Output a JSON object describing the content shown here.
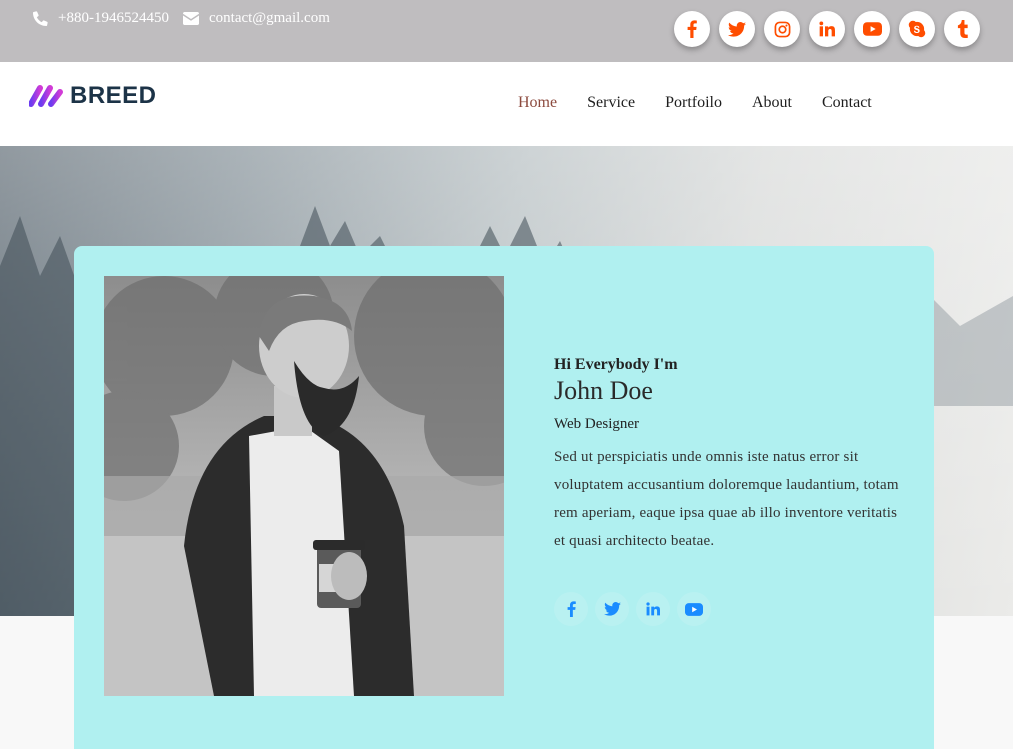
{
  "topbar": {
    "phone": "+880-1946524450",
    "email": "contact@gmail.com",
    "social_icons": [
      "facebook-icon",
      "twitter-icon",
      "instagram-icon",
      "linkedin-icon",
      "youtube-icon",
      "skype-icon",
      "tumblr-icon"
    ],
    "social_color": "#ff4d00"
  },
  "brand": {
    "name": "BREED"
  },
  "nav": {
    "items": [
      "Home",
      "Service",
      "Portfoilo",
      "About",
      "Contact"
    ],
    "active": "Home",
    "active_color": "#8c4a3e"
  },
  "profile": {
    "greeting": "Hi Everybody I'm",
    "name": "John Doe",
    "role": "Web Designer",
    "bio": "Sed ut perspiciatis unde omnis iste natus error sit voluptatem accusantium doloremque laudantium, totam rem aperiam, eaque ipsa quae ab illo inventore veritatis et quasi architecto beatae.",
    "social_icons": [
      "facebook-icon",
      "twitter-icon",
      "linkedin-icon",
      "youtube-icon"
    ],
    "social_color": "#1a8cff"
  },
  "colors": {
    "card_bg": "#b0f0f0",
    "topbar_bg": "#bfbdbf"
  }
}
